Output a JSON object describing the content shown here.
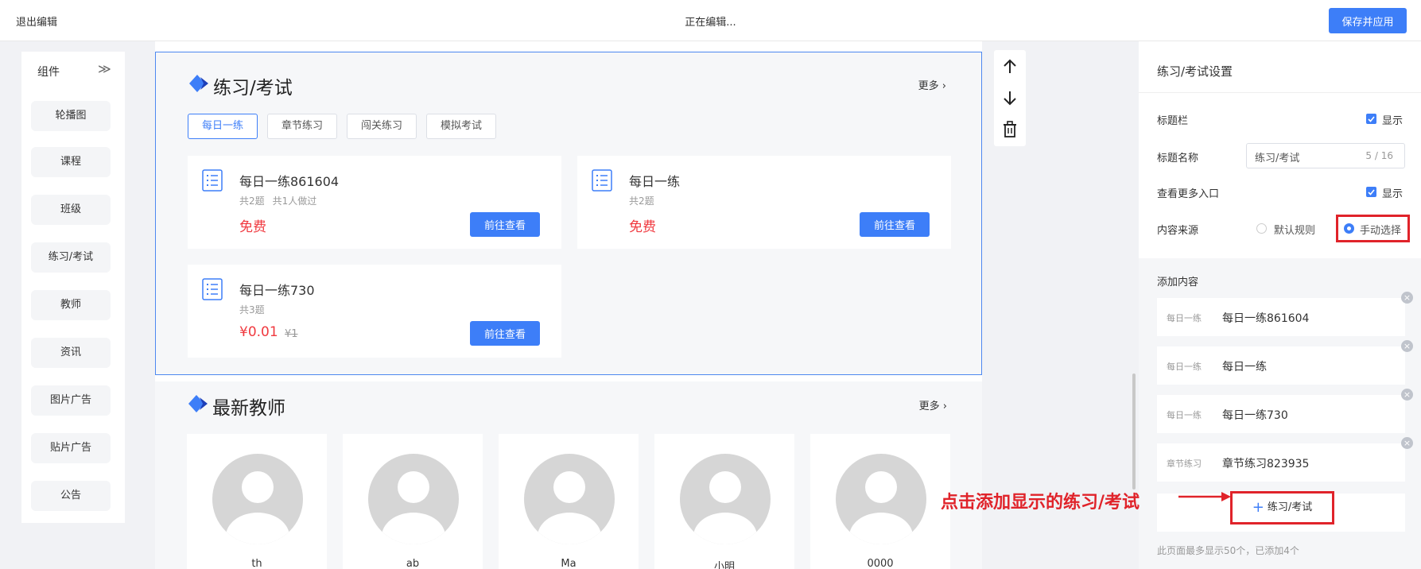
{
  "topbar": {
    "exit_label": "退出编辑",
    "status": "正在编辑...",
    "save_label": "保存并应用"
  },
  "components": {
    "title": "组件",
    "collapse_icon": "double-chevron-right-icon",
    "items": [
      "轮播图",
      "课程",
      "班级",
      "练习/考试",
      "教师",
      "资讯",
      "图片广告",
      "贴片广告",
      "公告"
    ]
  },
  "exam_module": {
    "title": "练习/考试",
    "more": "更多 ›",
    "tabs": [
      "每日一练",
      "章节练习",
      "闯关练习",
      "模拟考试"
    ],
    "active_tab": "每日一练",
    "cards": [
      {
        "title": "每日一练861604",
        "meta": [
          "共2题",
          "共1人做过"
        ],
        "price": "免费",
        "orig_price": "",
        "button": "前往查看"
      },
      {
        "title": "每日一练",
        "meta": [
          "共2题"
        ],
        "price": "免费",
        "orig_price": "",
        "button": "前往查看"
      },
      {
        "title": "每日一练730",
        "meta": [
          "共3题"
        ],
        "price": "¥0.01",
        "orig_price": "¥1",
        "button": "前往查看"
      }
    ]
  },
  "teacher_module": {
    "title": "最新教师",
    "more": "更多 ›",
    "teachers": [
      "th",
      "ab",
      "Ma",
      "小明",
      "0000"
    ]
  },
  "tools": {
    "icons": [
      "arrow-up-icon",
      "arrow-down-icon",
      "trash-icon"
    ]
  },
  "settings": {
    "title": "练习/考试设置",
    "title_bar_label": "标题栏",
    "show_label": "显示",
    "title_name_label": "标题名称",
    "title_value": "练习/考试",
    "title_count": "5 / 16",
    "more_entry_label": "查看更多入口",
    "source_label": "内容来源",
    "source_options": [
      "默认规则",
      "手动选择"
    ],
    "source_selected": "手动选择",
    "add_content_title": "添加内容",
    "items": [
      {
        "type": "每日一练",
        "name": "每日一练861604"
      },
      {
        "type": "每日一练",
        "name": "每日一练"
      },
      {
        "type": "每日一练",
        "name": "每日一练730"
      },
      {
        "type": "章节练习",
        "name": "章节练习823935"
      }
    ],
    "add_button": "练习/考试",
    "hint": "此页面最多显示50个，已添加4个"
  },
  "annotation": "点击添加显示的练习/考试",
  "colors": {
    "primary": "#3d7ef8",
    "price_red": "#f0393f",
    "annotation_red": "#e0232a",
    "module_border": "#4d88f0"
  }
}
